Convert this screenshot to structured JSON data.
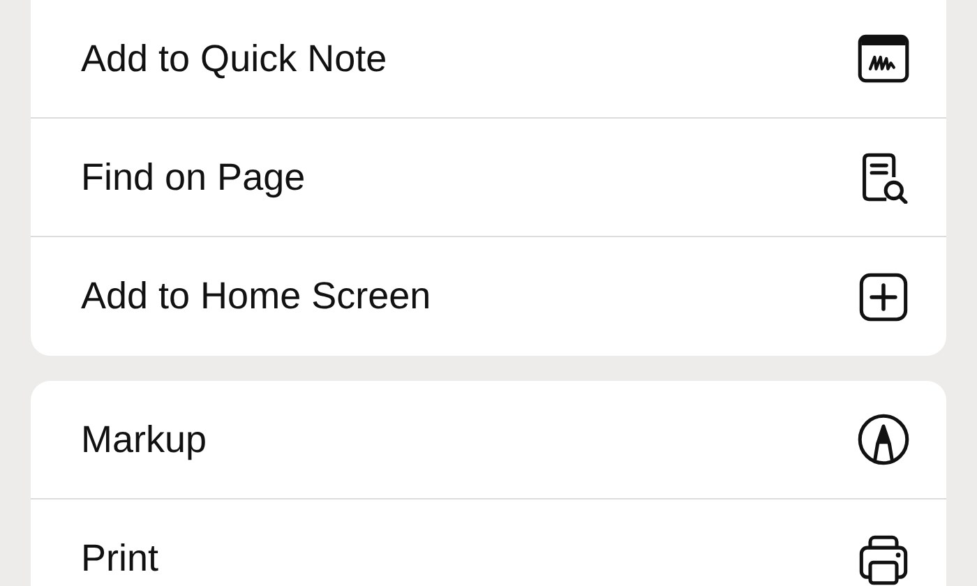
{
  "sections": [
    {
      "items": [
        {
          "label": "Add to Quick Note",
          "kind": "quick-note"
        },
        {
          "label": "Find on Page",
          "kind": "find"
        },
        {
          "label": "Add to Home Screen",
          "kind": "add"
        }
      ]
    },
    {
      "items": [
        {
          "label": "Markup",
          "kind": "markup"
        },
        {
          "label": "Print",
          "kind": "print"
        }
      ]
    }
  ]
}
